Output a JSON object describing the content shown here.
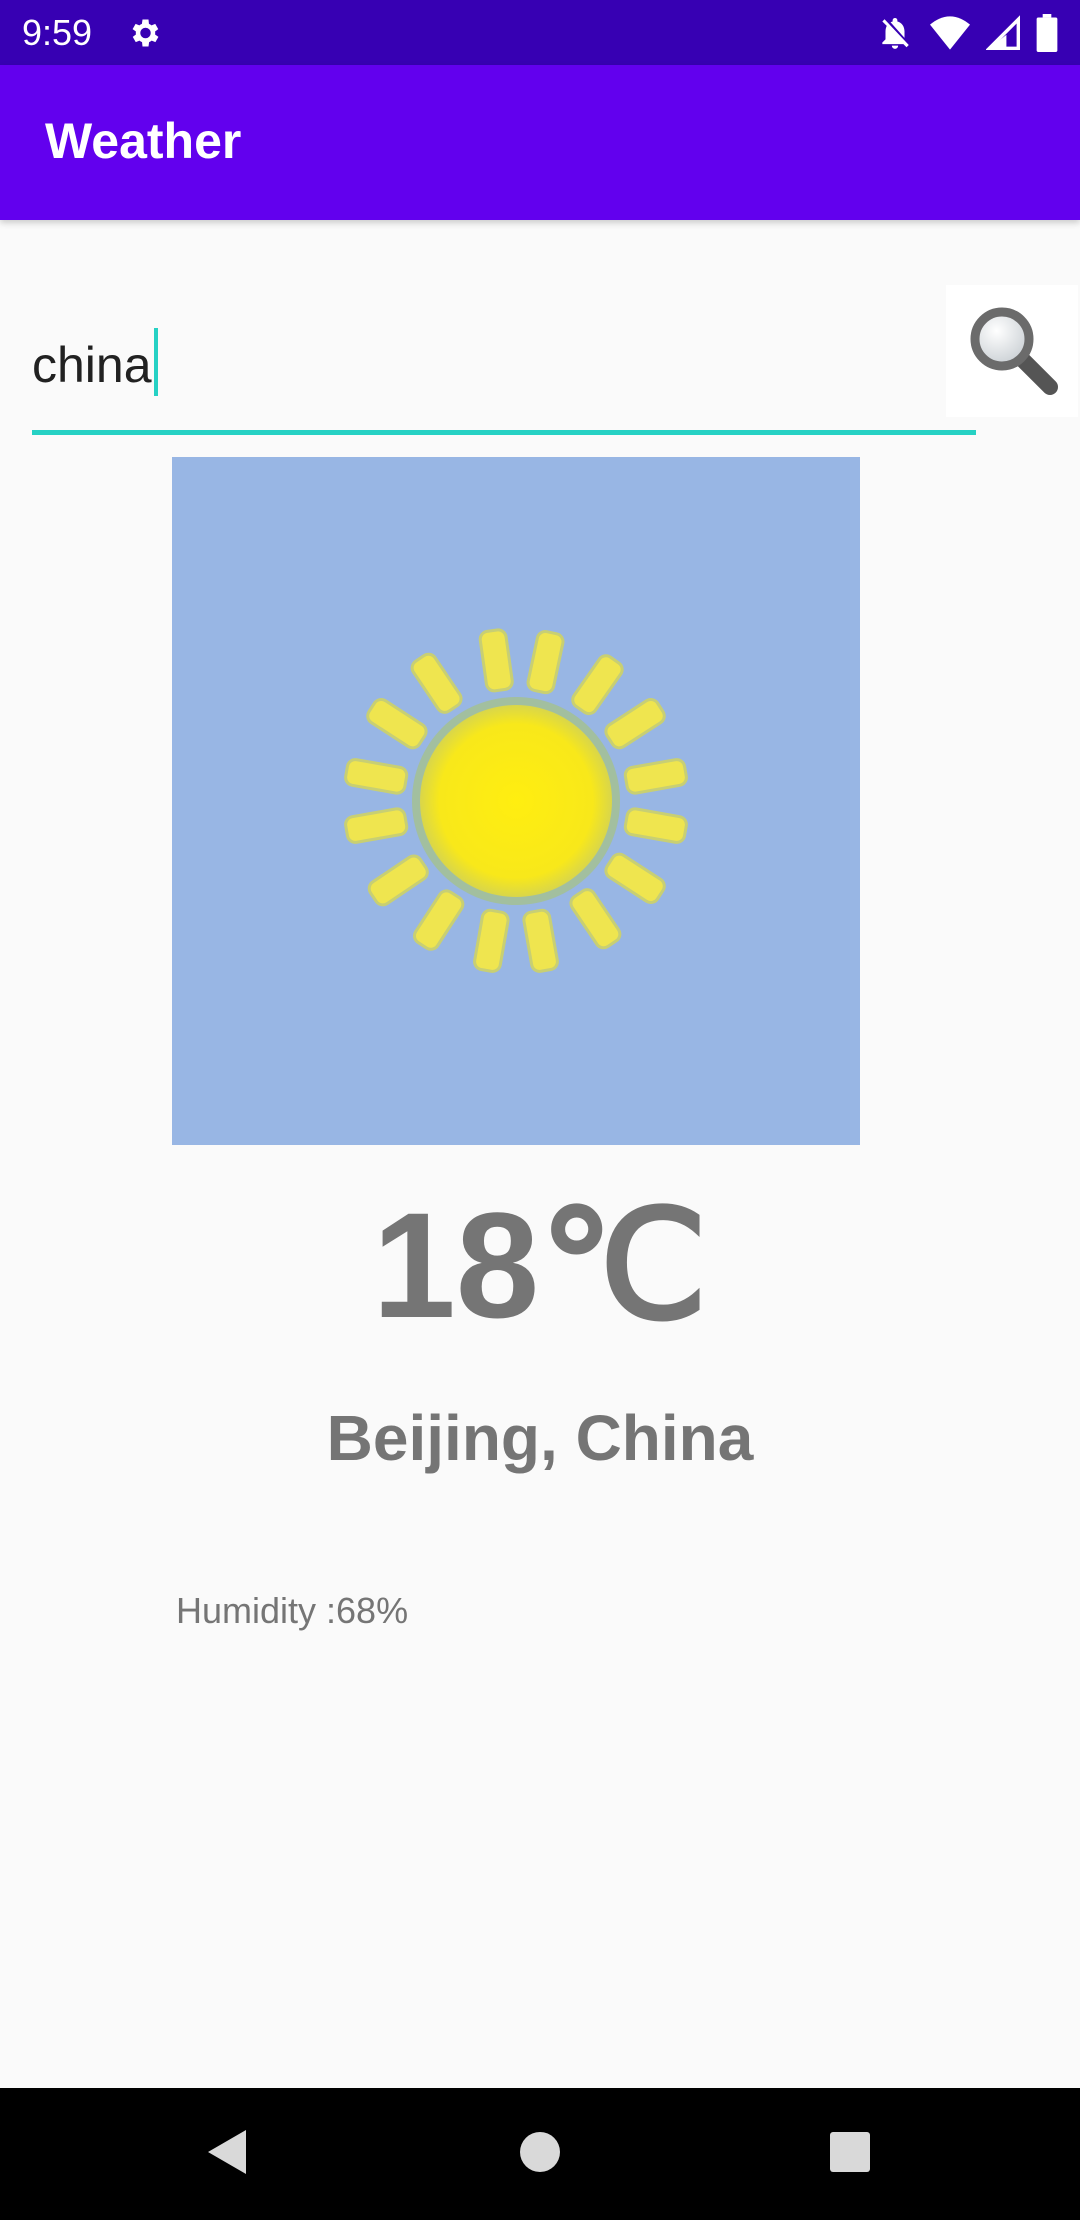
{
  "status_bar": {
    "time": "9:59",
    "icons": [
      "gear-icon",
      "notifications-off-icon",
      "wifi-icon",
      "cellular-signal-icon",
      "battery-icon"
    ]
  },
  "app_bar": {
    "title": "Weather"
  },
  "search": {
    "value": "china",
    "button_icon": "magnifier-search-icon",
    "accent_color": "#26d1c4"
  },
  "weather": {
    "icon": "sunny-icon",
    "temperature": "18℃",
    "location": "Beijing, China",
    "humidity": "Humidity :68%"
  },
  "nav_bar": {
    "icons": [
      "back-icon",
      "home-icon",
      "recents-icon"
    ]
  },
  "colors": {
    "status_bar": "#3700b3",
    "app_bar": "#6200ee",
    "image_background": "#98b6e4",
    "text_secondary": "#757575"
  }
}
